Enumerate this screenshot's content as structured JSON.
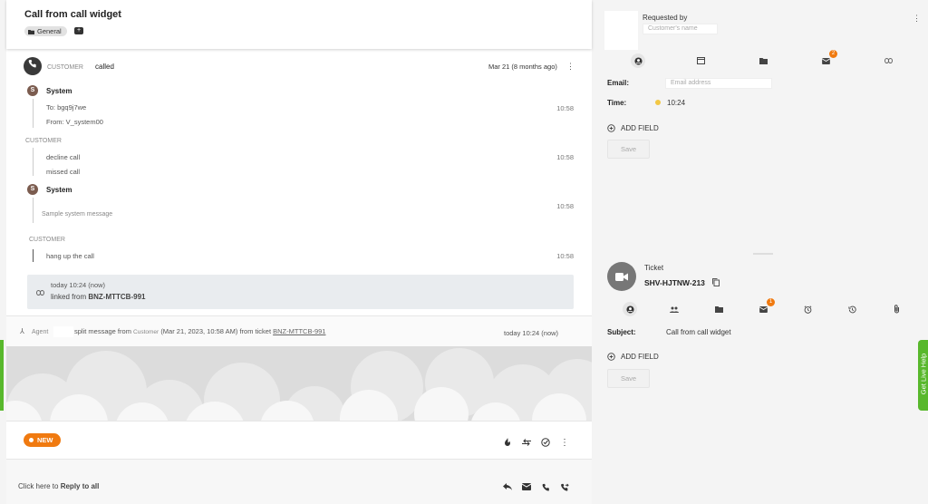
{
  "header": {
    "title": "Call from call widget",
    "tag": "General"
  },
  "call_event": {
    "role": "CUSTOMER",
    "action": "called",
    "date": "Mar 21 (8 months ago)"
  },
  "messages": {
    "system1_name": "System",
    "system1_initial": "S",
    "system1_to": "To: bgq9j7we",
    "system1_from": "From: V_system00",
    "system1_time": "10:58",
    "customer_label1": "CUSTOMER",
    "decline": "decline call",
    "missed": "missed call",
    "customer1_time": "10:58",
    "system2_name": "System",
    "system2_initial": "S",
    "system2_text": "Sample system message",
    "system2_time": "10:58",
    "customer_label2": "CUSTOMER",
    "hangup": "hang up the call",
    "customer2_time": "10:58"
  },
  "linked": {
    "time": "today 10:24 (now)",
    "prefix": "linked from",
    "ticket": "BNZ-MTTCB-991"
  },
  "split": {
    "agent": "Agent",
    "text1": "split message from",
    "customer": "Customer",
    "text2": "(Mar 21, 2023, 10:58 AM) from ticket",
    "ticket": "BNZ-MTTCB-991",
    "time": "today 10:24 (now)"
  },
  "status": {
    "badge": "NEW"
  },
  "reply": {
    "prefix": "Click here to",
    "action": "Reply to all"
  },
  "requester": {
    "title": "Requested by",
    "name_placeholder": "Customer's name",
    "email_label": "Email:",
    "email_placeholder": "Email address",
    "time_label": "Time:",
    "time_value": "10:24",
    "add_field": "ADD FIELD",
    "save": "Save",
    "mail_badge": "2"
  },
  "ticket": {
    "label": "Ticket",
    "id": "SHV-HJTNW-213",
    "subject_label": "Subject:",
    "subject_value": "Call from call widget",
    "add_field": "ADD FIELD",
    "save": "Save",
    "mail_badge": "1"
  },
  "live_help": "Get Live Help",
  "colors": {
    "accent_orange": "#f07a10",
    "live_help_green": "#58b82c",
    "status_dot": "#f2c744"
  }
}
